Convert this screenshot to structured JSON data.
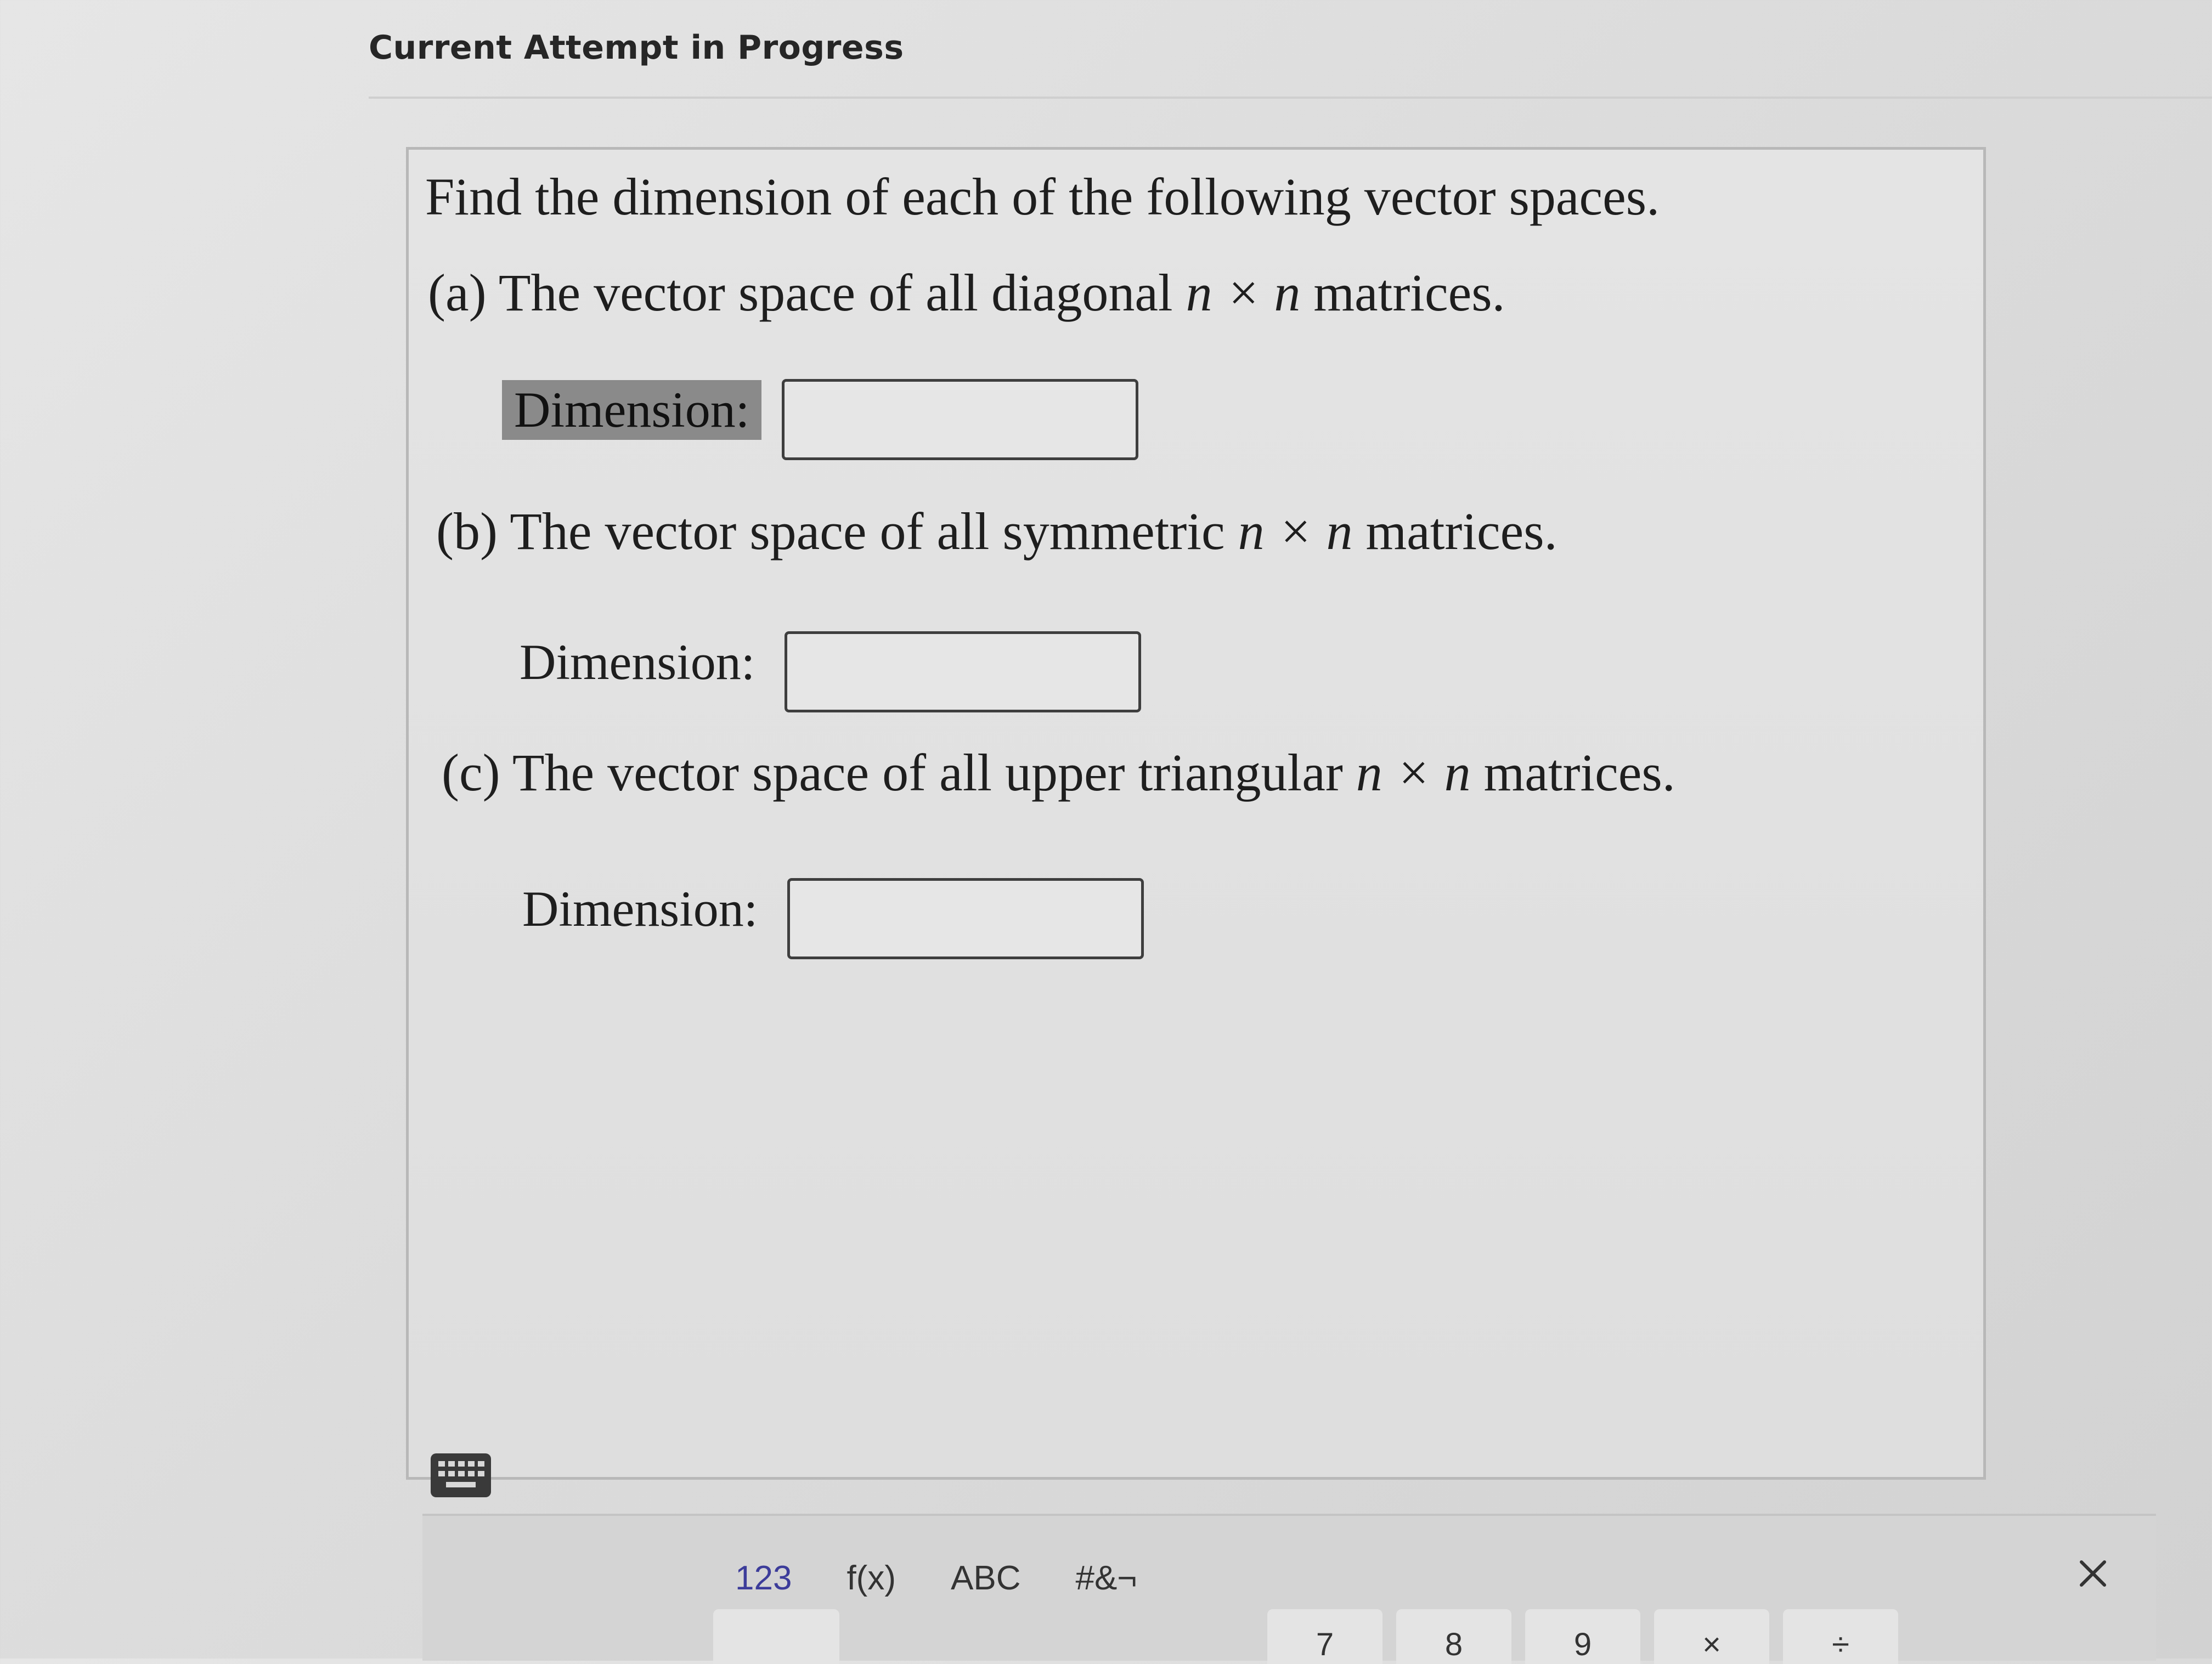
{
  "header": {
    "title": "Current Attempt in Progress"
  },
  "question": {
    "intro": "Find the dimension of each of the following vector spaces.",
    "parts": [
      {
        "prefix": "(a) The vector space of all diagonal",
        "math": "n × n",
        "suffix": "matrices.",
        "label": "Dimension:",
        "value": ""
      },
      {
        "prefix": "(b) The vector space of all symmetric",
        "math": "n × n",
        "suffix": "matrices.",
        "label": "Dimension:",
        "value": ""
      },
      {
        "prefix": "(c) The vector space of all upper triangular",
        "math": "n × n",
        "suffix": "matrices.",
        "label": "Dimension:",
        "value": ""
      }
    ]
  },
  "keyboard": {
    "tabs": [
      "123",
      "f(x)",
      "ABC",
      "#&¬"
    ],
    "active_tab": "123",
    "keys": [
      "",
      "7",
      "8",
      "9",
      "×",
      "÷"
    ],
    "toggle_icon": "keyboard-icon",
    "close_icon": "close-icon"
  },
  "colors": {
    "background": "#dcdcdc",
    "highlight": "#8a8a8a",
    "active_tab": "#3c3c9a"
  }
}
